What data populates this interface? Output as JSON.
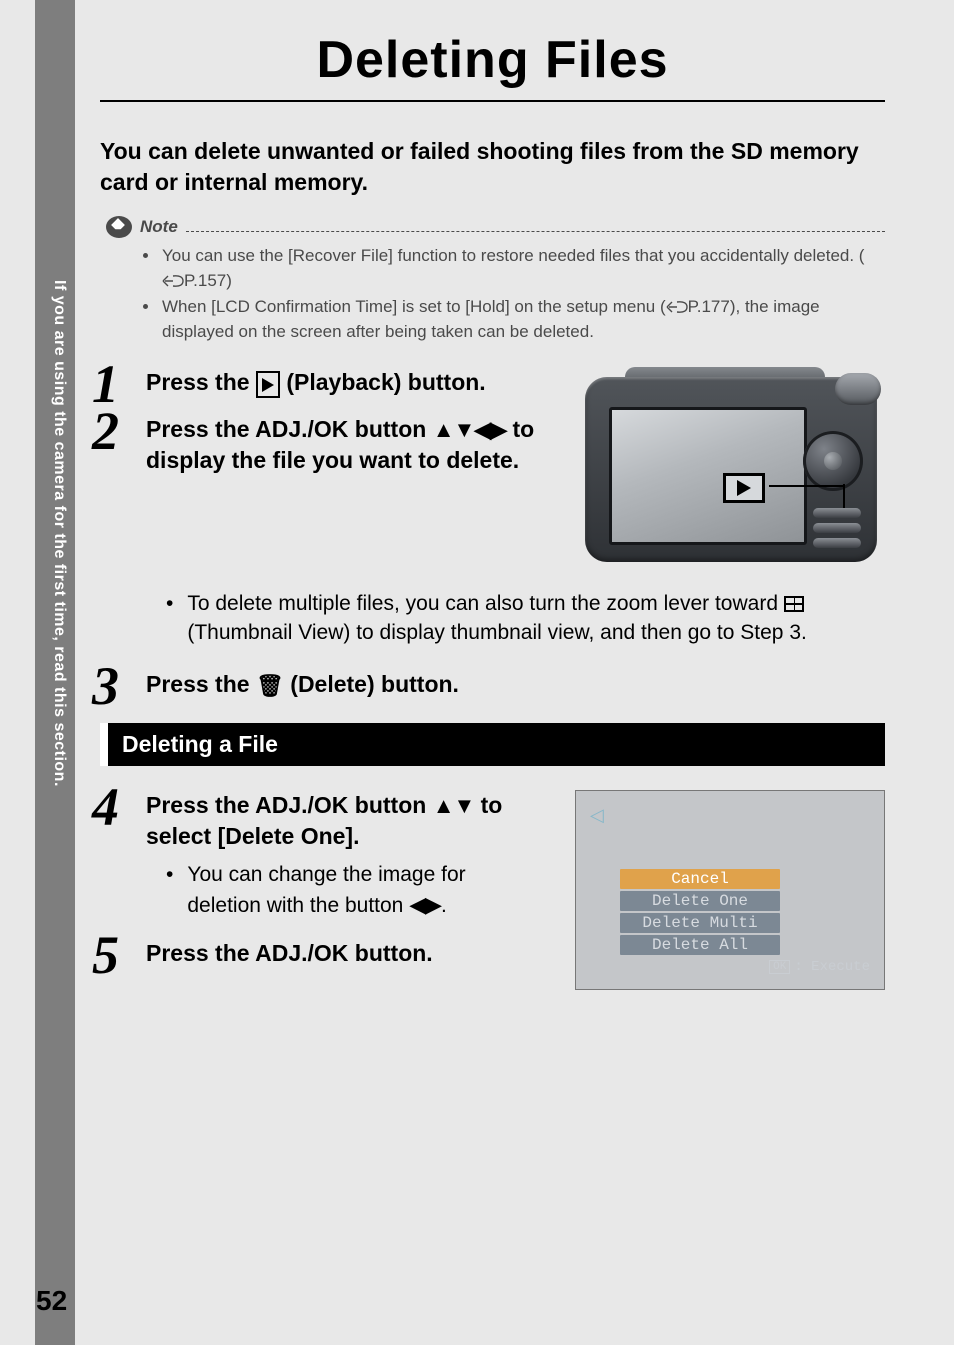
{
  "sidebar_text": "If you are using the camera for the first time, read this section.",
  "title": "Deleting Files",
  "intro": "You can delete unwanted or failed shooting files from the SD memory card or internal memory.",
  "note": {
    "label": "Note",
    "items": [
      {
        "pre": "You can use the [Recover File] function to restore needed files that you accidentally deleted. (",
        "ref": "P.157",
        "post": ")"
      },
      {
        "pre": "When [LCD Confirmation Time] is set to [Hold] on the setup menu (",
        "ref": "P.177",
        "post": "), the image displayed on the screen after being taken can be deleted."
      }
    ]
  },
  "steps": {
    "s1": {
      "num": "1",
      "pre": "Press the ",
      "post": " (Playback) button."
    },
    "s2": {
      "num": "2",
      "pre": "Press the ADJ./OK button ",
      "arrows": "▲▼◀▶",
      "post": " to display the file you want to delete.",
      "bullet_pre": "To delete multiple files, you can also turn the zoom lever toward ",
      "bullet_post": " (Thumbnail View) to display thumbnail view, and then go to Step 3."
    },
    "s3": {
      "num": "3",
      "pre": "Press the ",
      "post": " (Delete) button."
    }
  },
  "section_bar": "Deleting a File",
  "steps2": {
    "s4": {
      "num": "4",
      "line1_pre": "Press the ADJ./OK button ",
      "line1_arrows": "▲▼",
      "line1_post": " to select [Delete One].",
      "bullet_pre": "You can change the image for deletion with the button ",
      "bullet_arrows": "◀▶",
      "bullet_post": "."
    },
    "s5": {
      "num": "5",
      "text": "Press the ADJ./OK button."
    }
  },
  "menu": {
    "items": [
      "Cancel",
      "Delete One",
      "Delete Multi",
      "Delete All"
    ],
    "selected_index": 0,
    "ok_label": "OK",
    "execute_label": ": Execute"
  },
  "page_number": "52"
}
